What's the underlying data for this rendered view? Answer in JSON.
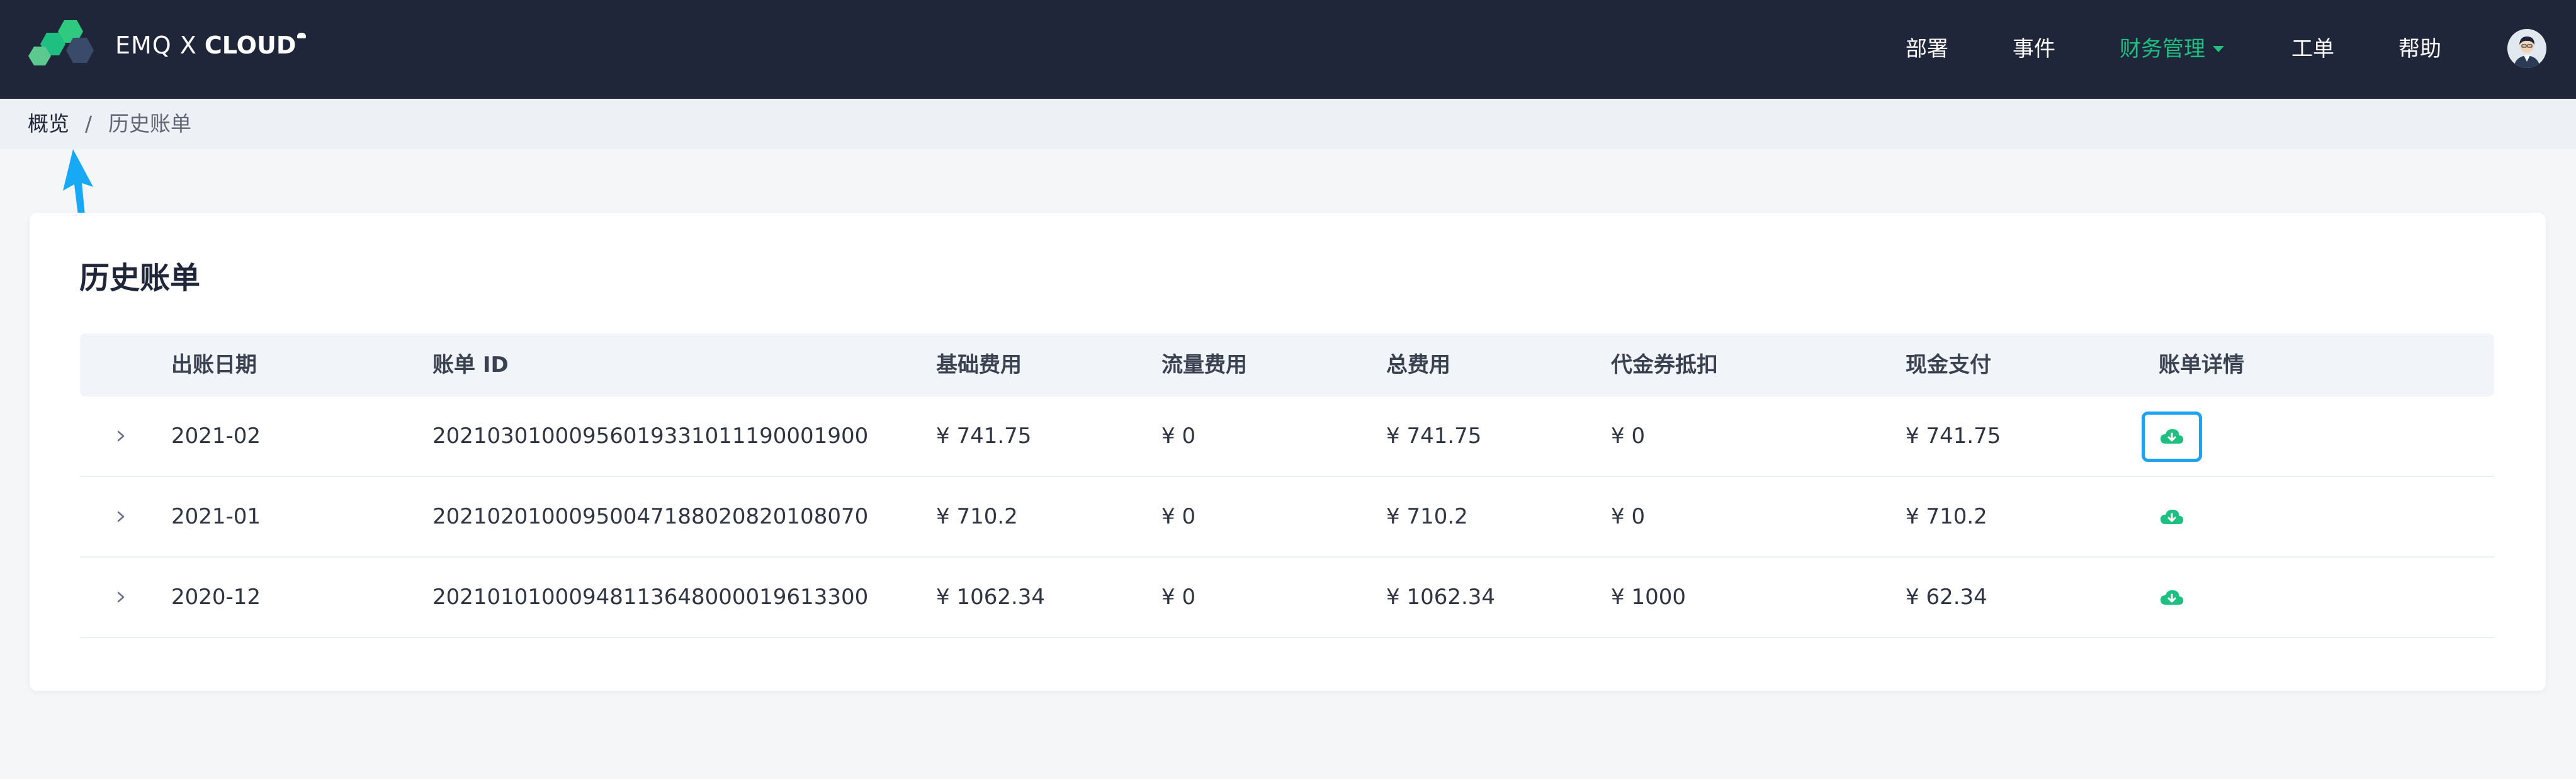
{
  "brand": {
    "light": "EMQ X",
    "bold": "CLOUD",
    "logo_icon": "hexagon-cluster-logo",
    "colors": [
      "#1fbf82",
      "#5cc98f",
      "#3a4a6b"
    ]
  },
  "nav": {
    "items": [
      {
        "label": "部署",
        "active": false
      },
      {
        "label": "事件",
        "active": false
      },
      {
        "label": "财务管理",
        "active": true,
        "dropdown": true
      },
      {
        "label": "工单",
        "active": false
      },
      {
        "label": "帮助",
        "active": false
      }
    ],
    "active_color": "#1fbf82",
    "avatar_icon": "user-avatar-icon"
  },
  "breadcrumb": {
    "home": "概览",
    "separator": "/",
    "current": "历史账单"
  },
  "page": {
    "title": "历史账单"
  },
  "table": {
    "headers": {
      "date": "出账日期",
      "id": "账单 ID",
      "base": "基础费用",
      "flow": "流量费用",
      "total": "总费用",
      "voucher": "代金券抵扣",
      "cash": "现金支付",
      "detail": "账单详情"
    },
    "rows": [
      {
        "date": "2021-02",
        "id": "20210301000956019331011190001900",
        "base": "¥ 741.75",
        "flow": "¥ 0",
        "total": "¥ 741.75",
        "voucher": "¥ 0",
        "cash": "¥ 741.75",
        "focused": true
      },
      {
        "date": "2021-01",
        "id": "20210201000950047188020820108070",
        "base": "¥ 710.2",
        "flow": "¥ 0",
        "total": "¥ 710.2",
        "voucher": "¥ 0",
        "cash": "¥ 710.2",
        "focused": false
      },
      {
        "date": "2020-12",
        "id": "20210101000948113648000019613300",
        "base": "¥ 1062.34",
        "flow": "¥ 0",
        "total": "¥ 1062.34",
        "voucher": "¥ 1000",
        "cash": "¥ 62.34",
        "focused": false
      }
    ],
    "download_icon": "cloud-download-icon",
    "download_color": "#1fbf82",
    "focus_color": "#1da1f2"
  },
  "annotation": {
    "arrow_color": "#17a9f5"
  }
}
